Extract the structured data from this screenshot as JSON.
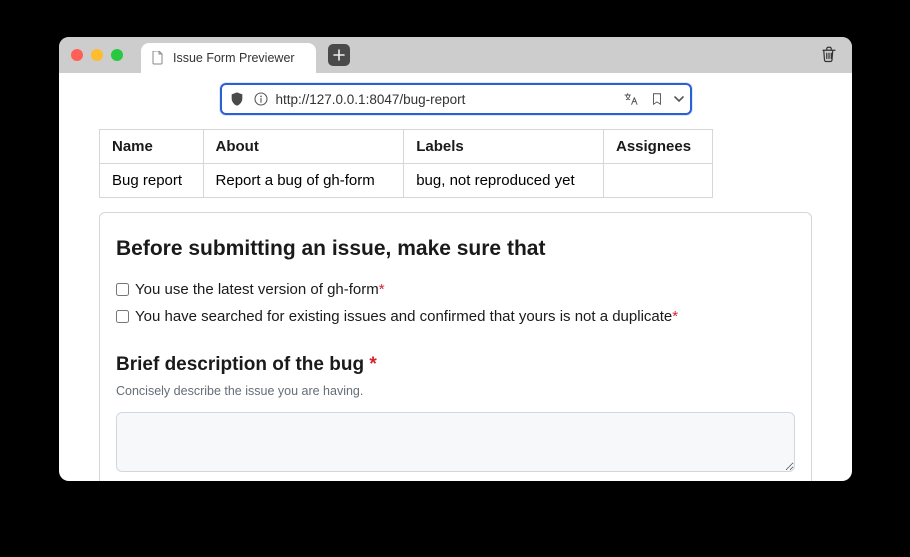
{
  "tab": {
    "title": "Issue Form Previewer"
  },
  "address": {
    "url": "http://127.0.0.1:8047/bug-report"
  },
  "table": {
    "headers": {
      "name": "Name",
      "about": "About",
      "labels": "Labels",
      "assignees": "Assignees"
    },
    "row": {
      "name": "Bug report",
      "about": "Report a bug of gh-form",
      "labels": "bug, not reproduced yet",
      "assignees": ""
    }
  },
  "form": {
    "preamble_title": "Before submitting an issue, make sure that",
    "checks": {
      "c1": "You use the latest version of gh-form",
      "c2": "You have searched for existing issues and confirmed that yours is not a duplicate"
    },
    "brief": {
      "title": "Brief description of the bug ",
      "required": "*",
      "help": "Concisely describe the issue you are having."
    },
    "asterisk": "*"
  }
}
